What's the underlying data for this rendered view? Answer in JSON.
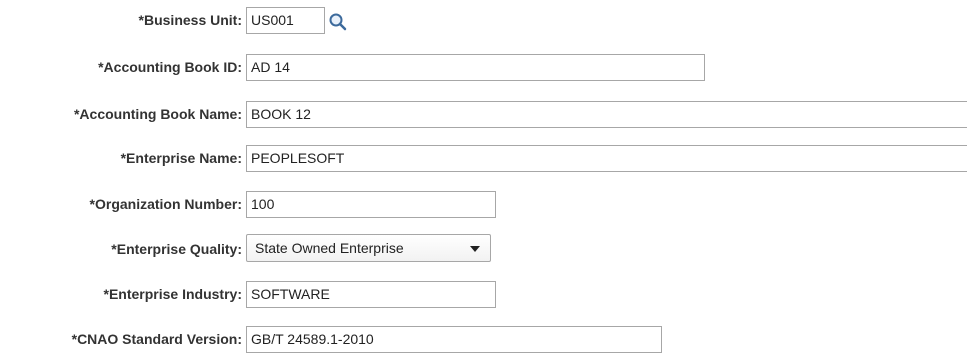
{
  "form": {
    "business_unit": {
      "label": "*Business Unit:",
      "value": "US001"
    },
    "accounting_book_id": {
      "label": "*Accounting Book ID:",
      "value": "AD 14"
    },
    "accounting_book_name": {
      "label": "*Accounting Book Name:",
      "value": "BOOK 12"
    },
    "enterprise_name": {
      "label": "*Enterprise Name:",
      "value": "PEOPLESOFT"
    },
    "organization_number": {
      "label": "*Organization Number:",
      "value": "100"
    },
    "enterprise_quality": {
      "label": "*Enterprise Quality:",
      "value": "State Owned Enterprise"
    },
    "enterprise_industry": {
      "label": "*Enterprise Industry:",
      "value": "SOFTWARE"
    },
    "cnao_standard_version": {
      "label": "*CNAO Standard Version:",
      "value": "GB/T 24589.1-2010"
    }
  },
  "icons": {
    "lookup": "magnifying-glass-icon",
    "dropdown": "chevron-down-icon"
  },
  "colors": {
    "border": "#a7a7a7",
    "label_text": "#333333",
    "lookup_icon": "#3c6a9c"
  }
}
